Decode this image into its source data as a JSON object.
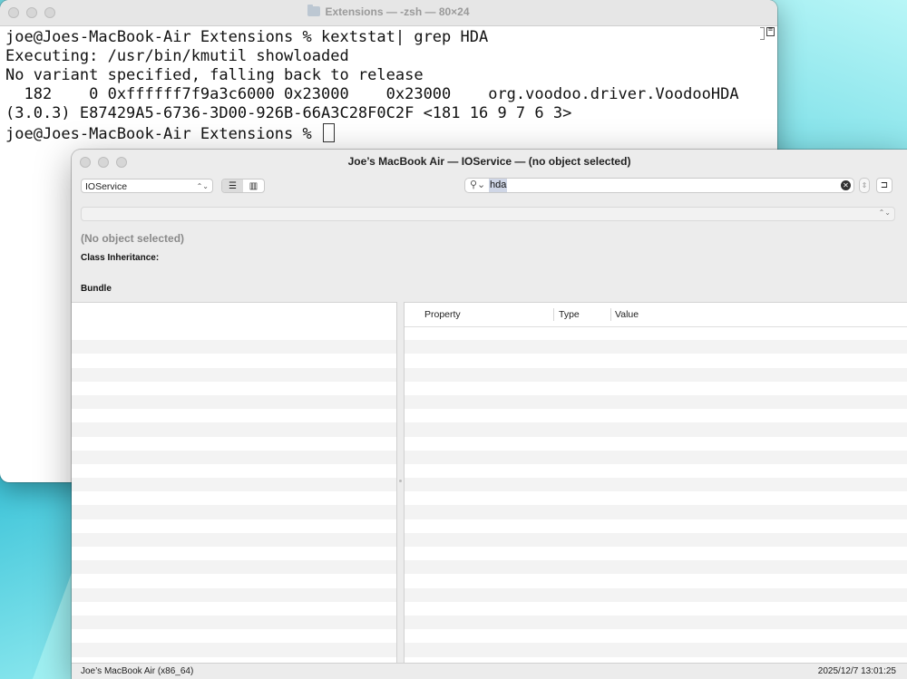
{
  "terminal": {
    "title": "Extensions — -zsh — 80×24",
    "lines": [
      "joe@Joes-MacBook-Air Extensions % kextstat| grep HDA",
      "Executing: /usr/bin/kmutil showloaded",
      "No variant specified, falling back to release",
      "  182    0 0xffffff7f9a3c6000 0x23000    0x23000    org.voodoo.driver.VoodooHDA",
      "(3.0.3) E87429A5-6736-3D00-926B-66A3C28F0C2F <181 16 9 7 6 3>"
    ],
    "prompt": "joe@Joes-MacBook-Air Extensions % "
  },
  "ioreg": {
    "title": "Joe’s MacBook Air — IOService — (no object selected)",
    "plane_select": "IOService",
    "search_value": "hda",
    "selected_object": "(No object selected)",
    "class_inheritance_label": "Class Inheritance:",
    "bundle_label": "Bundle",
    "columns": {
      "property": "Property",
      "type": "Type",
      "value": "Value"
    },
    "status_left": "Joe’s MacBook Air (x86_64)",
    "status_right": "2025/12/7 13:01:25"
  },
  "icons": [
    "folder-icon",
    "list-view-icon",
    "column-view-icon",
    "search-icon",
    "clear-search-icon",
    "inspector-icon",
    "terminal-menu-icon"
  ],
  "colors": {
    "search_highlight": "#cfd6e6",
    "window_bg": "#ececec",
    "stripe": "#f3f3f3"
  }
}
